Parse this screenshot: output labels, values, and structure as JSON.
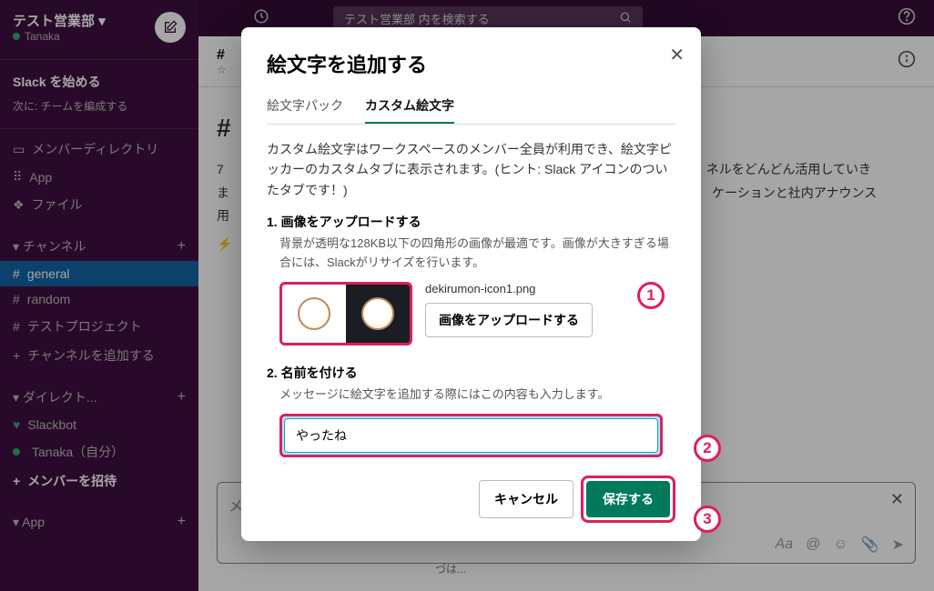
{
  "workspace": {
    "name": "テスト営業部",
    "user": "Tanaka"
  },
  "topbar": {
    "search_placeholder": "テスト営業部 内を検索する"
  },
  "sidebar": {
    "start_title": "Slack を始める",
    "start_sub": "次に: チームを編成する",
    "quick": [
      "メンバーディレクトリ",
      "App",
      "ファイル"
    ],
    "channels_header": "チャンネル",
    "channels": [
      "general",
      "random",
      "テストプロジェクト"
    ],
    "add_channel": "チャンネルを追加する",
    "dm_header": "ダイレクト...",
    "dms": [
      {
        "name": "Slackbot",
        "heart": true
      },
      {
        "name": "Tanaka（自分）",
        "online": true
      }
    ],
    "invite": "メンバーを招待",
    "app_header": "App"
  },
  "channel": {
    "name": "#",
    "body_line1": "ネルをどんどん活用していき",
    "body_line2": "ケーションと社内アナウンス",
    "body_prefix1": "7",
    "body_prefix2": "ま",
    "body_prefix3": "用",
    "below_modal": "づは..."
  },
  "message_box": {
    "placeholder": "メ"
  },
  "modal": {
    "title": "絵文字を追加する",
    "tabs": [
      "絵文字パック",
      "カスタム絵文字"
    ],
    "active_tab": 1,
    "intro": "カスタム絵文字はワークスペースのメンバー全員が利用でき、絵文字ピッカーのカスタムタブに表示されます。(ヒント: Slack アイコンのついたタブです！)",
    "step1_title": "1. 画像をアップロードする",
    "step1_desc": "背景が透明な128KB以下の四角形の画像が最適です。画像が大きすぎる場合には、Slackがリサイズを行います。",
    "filename": "dekirumon-icon1.png",
    "upload_btn": "画像をアップロードする",
    "step2_title": "2. 名前を付ける",
    "step2_desc": "メッセージに絵文字を追加する際にはこの内容も入力します。",
    "name_value": "やったね",
    "cancel": "キャンセル",
    "save": "保存する"
  },
  "annotations": {
    "a1": "1",
    "a2": "2",
    "a3": "3"
  }
}
